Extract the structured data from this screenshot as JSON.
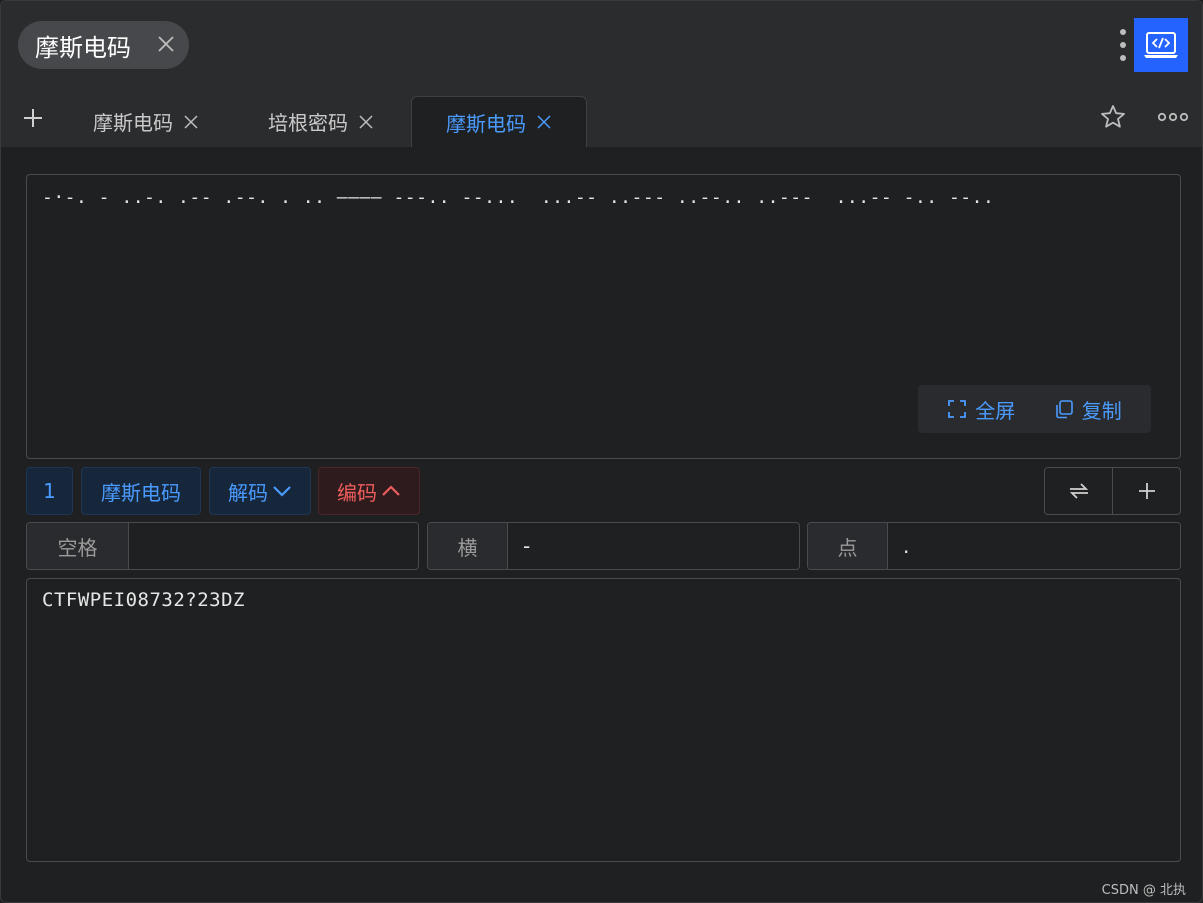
{
  "window": {
    "title": "摩斯电码"
  },
  "tabs": [
    {
      "label": "摩斯电码",
      "active": false
    },
    {
      "label": "培根密码",
      "active": false
    },
    {
      "label": "摩斯电码",
      "active": true
    }
  ],
  "input": {
    "text": "-·-. - ..-. .-- .--. . .. ———— ---.. --...  ...-- ..--- ..--.. ..---  ...-- -.. --.."
  },
  "input_actions": {
    "fullscreen": "全屏",
    "copy": "复制"
  },
  "toolbar": {
    "step": "1",
    "cipher": "摩斯电码",
    "decode": "解码",
    "encode": "编码"
  },
  "params": {
    "space": {
      "label": "空格",
      "value": ""
    },
    "dash": {
      "label": "横",
      "value": "-"
    },
    "dot": {
      "label": "点",
      "value": "."
    }
  },
  "output": {
    "text": "CTFWPEI08732?23DZ"
  },
  "watermark": "CSDN @    北执",
  "colors": {
    "accent": "#4a9bff",
    "danger": "#ef5d5d",
    "app_icon": "#2563ff"
  }
}
